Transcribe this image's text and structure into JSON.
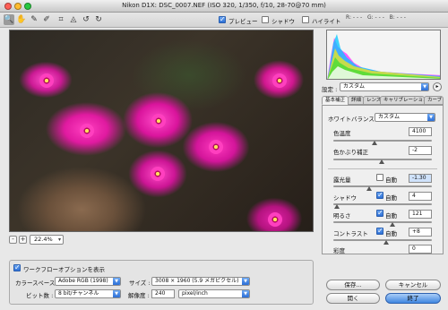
{
  "window": {
    "title": "Nikon D1X:  DSC_0007.NEF  (ISO 320, 1/350, f/10, 28-70@70 mm)"
  },
  "toolbar": {
    "tools": [
      "zoom-tool",
      "hand-tool",
      "white-balance-tool",
      "color-sampler-tool",
      "crop-tool",
      "straighten-tool",
      "rotate-left-tool",
      "rotate-right-tool"
    ],
    "preview": {
      "label": "プレビュー",
      "checked": true
    },
    "shadows": {
      "label": "シャドウ",
      "checked": false
    },
    "highlights": {
      "label": "ハイライト",
      "checked": false
    }
  },
  "rgb_readout": {
    "r": "R: - - -",
    "g": "G: - - -",
    "b": "B: - - -"
  },
  "zoom": {
    "value": "22.4%",
    "minus": "-",
    "plus": "+"
  },
  "settings": {
    "label": "設定 :",
    "value": "カスタム"
  },
  "tabs": [
    "基本補正",
    "詳細",
    "レンズ",
    "キャリブレーション",
    "カーブ"
  ],
  "adjust": {
    "white_balance": {
      "label": "ホワイトバランス :",
      "value": "カスタム"
    },
    "temperature": {
      "label": "色温度",
      "value": "4100",
      "fraction": 0.42
    },
    "tint": {
      "label": "色かぶり補正",
      "value": "-2",
      "fraction": 0.49
    },
    "exposure": {
      "label": "露光量",
      "auto_label": "自動",
      "auto": false,
      "value": "-1.30",
      "fraction": 0.36
    },
    "shadows": {
      "label": "シャドウ",
      "auto_label": "自動",
      "auto": true,
      "value": "4",
      "fraction": 0.04
    },
    "brightness": {
      "label": "明るさ",
      "auto_label": "自動",
      "auto": true,
      "value": "121",
      "fraction": 0.6
    },
    "contrast": {
      "label": "コントラスト",
      "auto_label": "自動",
      "auto": true,
      "value": "+8",
      "fraction": 0.54
    },
    "saturation": {
      "label": "彩度",
      "value": "0",
      "fraction": 0.5
    }
  },
  "workflow": {
    "show_label": "ワークフローオプションを表示",
    "checked": true,
    "colorspace": {
      "label": "カラースペース :",
      "value": "Adobe RGB (1998)"
    },
    "size": {
      "label": "サイズ :",
      "value": "3008 × 1960 (5.9 メガピクセル)"
    },
    "bitdepth": {
      "label": "ビット数 :",
      "value": "8 bit/チャンネル"
    },
    "resolution": {
      "label": "解像度 :",
      "value": "240",
      "unit": "pixel/inch"
    }
  },
  "buttons": {
    "save": "保存...",
    "cancel": "キャンセル",
    "open": "開く",
    "done": "終了"
  },
  "colors": {
    "accent": "#3f86e0",
    "flower": "#ff3fbf"
  }
}
